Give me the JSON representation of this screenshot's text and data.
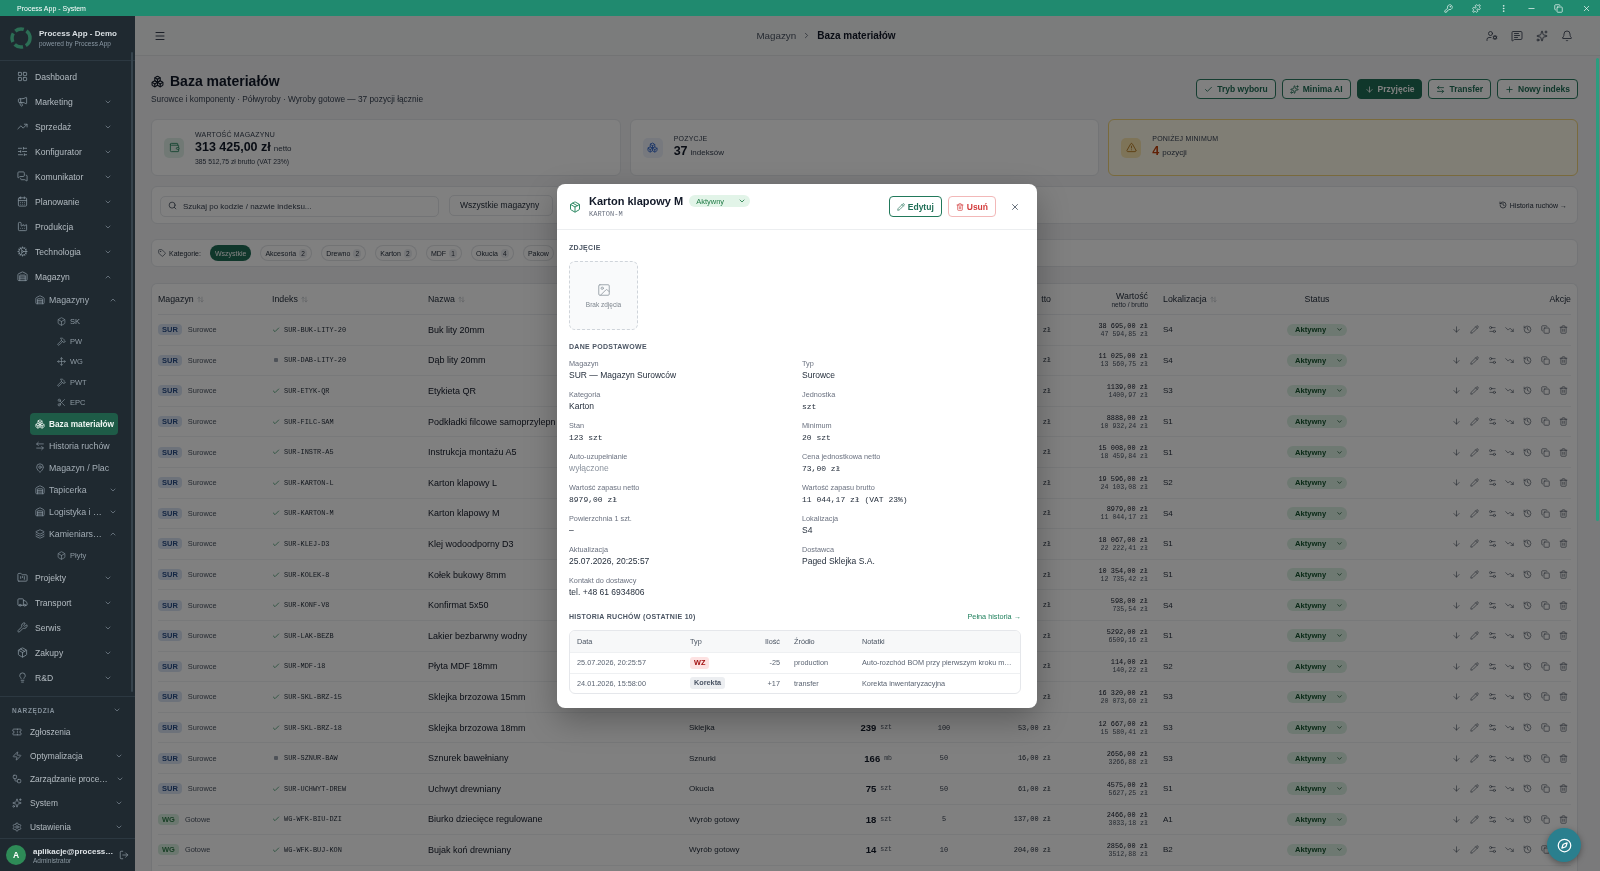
{
  "titlebar": {
    "title": "Process App - System"
  },
  "sidebar": {
    "app_name": "Process App - Demo",
    "app_tagline": "powered by Process App",
    "items": [
      {
        "label": "Dashboard",
        "selected": false
      },
      {
        "label": "Marketing",
        "selected": false,
        "expanded": false
      },
      {
        "label": "Sprzedaż",
        "selected": false,
        "expanded": false
      },
      {
        "label": "Konfigurator",
        "selected": false,
        "expanded": false
      },
      {
        "label": "Komunikator",
        "selected": false,
        "expanded": false
      },
      {
        "label": "Planowanie",
        "selected": false,
        "expanded": false
      },
      {
        "label": "Produkcja",
        "selected": false,
        "expanded": false
      },
      {
        "label": "Technologia",
        "selected": false,
        "expanded": false
      },
      {
        "label": "Magazyn",
        "selected": false,
        "expanded": true,
        "children": [
          {
            "label": "Magazyny",
            "selected": false,
            "expanded": true,
            "children": [
              {
                "label": "SK",
                "selected": false
              },
              {
                "label": "PW",
                "selected": false
              },
              {
                "label": "WG",
                "selected": false
              },
              {
                "label": "PWT",
                "selected": false
              },
              {
                "label": "EPC",
                "selected": false
              }
            ]
          },
          {
            "label": "Baza materiałów",
            "selected": true
          },
          {
            "label": "Historia ruchów",
            "selected": false
          },
          {
            "label": "Magazyn / Plac",
            "selected": false
          },
          {
            "label": "Tapicerka",
            "selected": false,
            "expanded": false
          },
          {
            "label": "Logistyka i …",
            "selected": false,
            "expanded": false
          },
          {
            "label": "Kamieniars…",
            "selected": false,
            "expanded": true,
            "children": [
              {
                "label": "Płyty",
                "selected": false
              }
            ]
          }
        ]
      },
      {
        "label": "Projekty",
        "selected": false,
        "expanded": false
      },
      {
        "label": "Transport",
        "selected": false,
        "expanded": false
      },
      {
        "label": "Serwis",
        "selected": false,
        "expanded": false
      },
      {
        "label": "Zakupy",
        "selected": false,
        "expanded": false
      },
      {
        "label": "R&D",
        "selected": false,
        "expanded": false
      }
    ],
    "tools": {
      "title": "NARZĘDZIA",
      "items": [
        {
          "label": "Zgłoszenia",
          "selected": false
        },
        {
          "label": "Optymalizacja",
          "selected": false,
          "expanded": false
        },
        {
          "label": "Zarządzanie proce…",
          "selected": false,
          "expanded": false
        },
        {
          "label": "System",
          "selected": false,
          "expanded": false
        },
        {
          "label": "Ustawienia",
          "selected": false,
          "expanded": false
        }
      ]
    },
    "user": {
      "initial": "A",
      "name": "aplikacje@process…",
      "role": "Administrator"
    }
  },
  "header": {
    "breadcrumb": [
      {
        "label": "Magazyn",
        "current": false
      },
      {
        "label": "Baza materiałów",
        "current": true
      }
    ]
  },
  "page": {
    "title": "Baza materiałów",
    "subtitle": "Surowce i komponenty · Półwyroby · Wyroby gotowe — 37 pozycji łącznie",
    "actions": [
      {
        "label": "Tryb wyboru",
        "kind": "outline"
      },
      {
        "label": "Minima AI",
        "kind": "outline"
      },
      {
        "label": "Przyjęcie",
        "kind": "primary"
      },
      {
        "label": "Transfer",
        "kind": "outline"
      },
      {
        "label": "Nowy indeks",
        "kind": "outline"
      }
    ]
  },
  "stats": [
    {
      "kind": "default",
      "label": "WARTOŚĆ MAGAZYNU",
      "value": "313 425,00 zł",
      "unit": "netto",
      "note": "385 512,75 zł brutto (VAT 23%)"
    },
    {
      "kind": "default",
      "label": "POZYCJE",
      "value": "37",
      "unit": "indeksów"
    },
    {
      "kind": "warning",
      "label": "PONIŻEJ MINIMUM",
      "value": "4",
      "unit": "pozycji"
    }
  ],
  "filters": {
    "search": {
      "placeholder": "Szukaj po kodzie / nazwie indeksu..."
    },
    "warehouse_select": "Wszystkie magazyny",
    "history_link": "Historia ruchów →"
  },
  "categories": {
    "label": "Kategorie:",
    "chips": [
      {
        "label": "Wszystkie",
        "selected": true
      },
      {
        "label": "Akcesoria",
        "count": "2",
        "selected": false
      },
      {
        "label": "Drewno",
        "count": "2",
        "selected": false
      },
      {
        "label": "Karton",
        "count": "2",
        "selected": false
      },
      {
        "label": "MDF",
        "count": "1",
        "selected": false
      },
      {
        "label": "Okucia",
        "count": "4",
        "selected": false
      },
      {
        "label": "Pakow",
        "selected": false
      }
    ]
  },
  "table": {
    "columns": {
      "warehouse": {
        "label": "Magazyn",
        "sortable": true
      },
      "index": {
        "label": "Indeks",
        "sortable": true
      },
      "name": {
        "label": "Nazwa",
        "sortable": true
      },
      "column_7": {
        "label": "tto"
      },
      "value": {
        "label": "Wartość",
        "sublabel": "netto / brutto"
      },
      "location": {
        "label": "Lokalizacja",
        "sortable": true
      },
      "status": {
        "label": "Status"
      },
      "actions": {
        "label": "Akcje"
      }
    },
    "rows": [
      {
        "warehouse": {
          "code": "SUR",
          "type": "Surowce",
          "color": "#6d727a"
        },
        "index": {
          "code": "SUR-BUK-LITY-20",
          "checked": true
        },
        "name": "Buk lity 20mm",
        "column_7": "zł",
        "value": {
          "net": "38 695,00 zł",
          "gross": "47 594,85 zł"
        },
        "location": "S4",
        "status": "Aktywny"
      },
      {
        "warehouse": {
          "code": "SUR",
          "type": "Surowce",
          "color": "#6d727a"
        },
        "index": {
          "code": "SUR-DAB-LITY-20",
          "checked": false
        },
        "name": "Dąb lity 20mm",
        "column_7": "zł",
        "value": {
          "net": "11 025,00 zł",
          "gross": "13 560,75 zł"
        },
        "location": "S4",
        "status": "Aktywny"
      },
      {
        "warehouse": {
          "code": "SUR",
          "type": "Surowce",
          "color": "#6d727a"
        },
        "index": {
          "code": "SUR-ETYK-QR",
          "checked": true
        },
        "name": "Etykieta QR",
        "column_7": "zł",
        "value": {
          "net": "1139,00 zł",
          "gross": "1400,97 zł"
        },
        "location": "S3",
        "status": "Aktywny"
      },
      {
        "warehouse": {
          "code": "SUR",
          "type": "Surowce",
          "color": "#6d727a"
        },
        "index": {
          "code": "SUR-FILC-SAM",
          "checked": true
        },
        "name": "Podkładki filcowe samoprzylepn",
        "column_7": "zł",
        "value": {
          "net": "8888,00 zł",
          "gross": "10 932,24 zł"
        },
        "location": "S1",
        "status": "Aktywny"
      },
      {
        "warehouse": {
          "code": "SUR",
          "type": "Surowce",
          "color": "#6d727a"
        },
        "index": {
          "code": "SUR-INSTR-A5",
          "checked": true
        },
        "name": "Instrukcja montażu A5",
        "column_7": "zł",
        "value": {
          "net": "15 008,00 zł",
          "gross": "18 459,84 zł"
        },
        "location": "S1",
        "status": "Aktywny"
      },
      {
        "warehouse": {
          "code": "SUR",
          "type": "Surowce",
          "color": "#6d727a"
        },
        "index": {
          "code": "SUR-KARTON-L",
          "checked": true
        },
        "name": "Karton klapowy L",
        "column_7": "zł",
        "value": {
          "net": "19 596,00 zł",
          "gross": "24 103,08 zł"
        },
        "location": "S2",
        "status": "Aktywny"
      },
      {
        "warehouse": {
          "code": "SUR",
          "type": "Surowce",
          "color": "#6d727a"
        },
        "index": {
          "code": "SUR-KARTON-M",
          "checked": true
        },
        "name": "Karton klapowy M",
        "column_7": "zł",
        "value": {
          "net": "8979,00 zł",
          "gross": "11 044,17 zł"
        },
        "location": "S4",
        "status": "Aktywny"
      },
      {
        "warehouse": {
          "code": "SUR",
          "type": "Surowce",
          "color": "#6d727a"
        },
        "index": {
          "code": "SUR-KLEJ-D3",
          "checked": true
        },
        "name": "Klej wodoodporny D3",
        "column_7": "zł",
        "value": {
          "net": "18 067,00 zł",
          "gross": "22 222,41 zł"
        },
        "location": "S1",
        "status": "Aktywny"
      },
      {
        "warehouse": {
          "code": "SUR",
          "type": "Surowce",
          "color": "#6d727a"
        },
        "index": {
          "code": "SUR-KOLEK-8",
          "checked": true
        },
        "name": "Kołek bukowy 8mm",
        "column_7": "zł",
        "value": {
          "net": "10 354,00 zł",
          "gross": "12 735,42 zł"
        },
        "location": "S1",
        "status": "Aktywny"
      },
      {
        "warehouse": {
          "code": "SUR",
          "type": "Surowce",
          "color": "#6d727a"
        },
        "index": {
          "code": "SUR-KONF-V8",
          "checked": true
        },
        "name": "Konfirmat 5x50",
        "column_7": "zł",
        "value": {
          "net": "598,00 zł",
          "gross": "735,54 zł"
        },
        "location": "S4",
        "status": "Aktywny"
      },
      {
        "warehouse": {
          "code": "SUR",
          "type": "Surowce",
          "color": "#6d727a"
        },
        "index": {
          "code": "SUR-LAK-BEZB",
          "checked": true
        },
        "name": "Lakier bezbarwny wodny",
        "column_7": "zł",
        "value": {
          "net": "5292,00 zł",
          "gross": "6509,16 zł"
        },
        "location": "S1",
        "status": "Aktywny"
      },
      {
        "warehouse": {
          "code": "SUR",
          "type": "Surowce",
          "color": "#6d727a"
        },
        "index": {
          "code": "SUR-MDF-18",
          "checked": true
        },
        "name": "Płyta MDF 18mm",
        "column_7": "zł",
        "value": {
          "net": "114,00 zł",
          "gross": "140,22 zł"
        },
        "location": "S2",
        "status": "Aktywny"
      },
      {
        "warehouse": {
          "code": "SUR",
          "type": "Surowce",
          "color": "#6d727a"
        },
        "index": {
          "code": "SUR-SKL-BRZ-15",
          "checked": true
        },
        "name": "Sklejka brzozowa 15mm",
        "column_7": "zł",
        "value": {
          "net": "16 320,00 zł",
          "gross": "20 073,60 zł"
        },
        "location": "S3",
        "status": "Aktywny"
      },
      {
        "warehouse": {
          "code": "SUR",
          "type": "Surowce",
          "color": "#6d727a"
        },
        "index": {
          "code": "SUR-SKL-BRZ-18",
          "checked": true
        },
        "name": "Sklejka brzozowa 18mm",
        "column_4": "Sklejka",
        "column_5": {
          "value": "239",
          "unit": "szt"
        },
        "column_6": "100",
        "column_7": "53,00 zł",
        "value": {
          "net": "12 667,00 zł",
          "gross": "15 580,41 zł"
        },
        "location": "S3",
        "status": "Aktywny"
      },
      {
        "warehouse": {
          "code": "SUR",
          "type": "Surowce",
          "color": "#6d727a"
        },
        "index": {
          "code": "SUR-SZNUR-BAW",
          "checked": false
        },
        "name": "Sznurek bawełniany",
        "column_4": "Sznurki",
        "column_5": {
          "value": "166",
          "unit": "mb"
        },
        "column_6": "50",
        "column_7": "16,00 zł",
        "value": {
          "net": "2656,00 zł",
          "gross": "3266,88 zł"
        },
        "location": "S3",
        "status": "Aktywny"
      },
      {
        "warehouse": {
          "code": "SUR",
          "type": "Surowce",
          "color": "#6d727a"
        },
        "index": {
          "code": "SUR-UCHWYT-DREW",
          "checked": true
        },
        "name": "Uchwyt drewniany",
        "column_4": "Okucia",
        "column_5": {
          "value": "75",
          "unit": "szt"
        },
        "column_6": "50",
        "column_7": "61,00 zł",
        "value": {
          "net": "4575,00 zł",
          "gross": "5627,25 zł"
        },
        "location": "S1",
        "status": "Aktywny"
      },
      {
        "warehouse": {
          "code": "WG",
          "type": "Gotowe",
          "color": "#6c7870"
        },
        "index": {
          "code": "WG-WFK-BIU-DZI",
          "checked": true
        },
        "name": "Biurko dziecięce regulowane",
        "column_4": "Wyrób gotowy",
        "column_5": {
          "value": "18",
          "unit": "szt"
        },
        "column_6": "5",
        "column_7": "137,00 zł",
        "value": {
          "net": "2466,00 zł",
          "gross": "3033,18 zł"
        },
        "location": "A1",
        "status": "Aktywny"
      },
      {
        "warehouse": {
          "code": "WG",
          "type": "Gotowe",
          "color": "#6c7870"
        },
        "index": {
          "code": "WG-WFK-BUJ-KON",
          "checked": true
        },
        "name": "Bujak koń drewniany",
        "column_4": "Wyrób gotowy",
        "column_5": {
          "value": "14",
          "unit": "szt"
        },
        "column_6": "10",
        "column_7": "204,00 zł",
        "value": {
          "net": "2856,00 zł",
          "gross": "3512,88 zł"
        },
        "location": "B2",
        "status": "Aktywny"
      }
    ]
  },
  "modal": {
    "title": "Karton klapowy M",
    "code": "KARTON-M",
    "status": "Aktywny",
    "buttons": [
      {
        "label": "Edytuj",
        "kind": "edit"
      },
      {
        "label": "Usuń",
        "kind": "delete"
      }
    ],
    "photo": {
      "title": "ZDJĘCIE",
      "empty_text": "Brak zdjęcia"
    },
    "details": {
      "title": "DANE PODSTAWOWE",
      "fields": [
        {
          "label": "Magazyn",
          "value": "SUR — Magazyn Surowców",
          "kind": "text"
        },
        {
          "label": "Typ",
          "value": "Surowce",
          "kind": "text"
        },
        {
          "label": "Kategoria",
          "value": "Karton",
          "kind": "text"
        },
        {
          "label": "Jednostka",
          "value": "szt",
          "kind": "mono"
        },
        {
          "label": "Stan",
          "value": "123 szt",
          "kind": "mono"
        },
        {
          "label": "Minimum",
          "value": "20 szt",
          "kind": "mono"
        },
        {
          "label": "Auto-uzupełnianie",
          "value": "wyłączone",
          "kind": "muted"
        },
        {
          "label": "Cena jednostkowa netto",
          "value": "73,00 zł",
          "kind": "mono"
        },
        {
          "label": "Wartość zapasu netto",
          "value": "8979,00 zł",
          "kind": "mono"
        },
        {
          "label": "Wartość zapasu brutto",
          "value": "11 044,17 zł (VAT 23%)",
          "kind": "mono"
        },
        {
          "label": "Powierzchnia 1 szt.",
          "value": "–",
          "kind": "text"
        },
        {
          "label": "Lokalizacja",
          "value": "S4",
          "kind": "text"
        },
        {
          "label": "Aktualizacja",
          "value": "25.07.2026, 20:25:57",
          "kind": "text"
        },
        {
          "label": "Dostawca",
          "value": "Paged Sklejka S.A.",
          "kind": "text"
        },
        {
          "label": "Kontakt do dostawcy",
          "value": "tel. +48 61 6934806",
          "kind": "text"
        }
      ]
    },
    "history": {
      "title": "HISTORIA RUCHÓW (OSTATNIE 10)",
      "link": "Pełna historia →",
      "columns": [
        "Data",
        "Typ",
        "Ilość",
        "Źródło",
        "Notatki"
      ],
      "rows": [
        {
          "date": "25.07.2026, 20:25:57",
          "type": "WZ",
          "color": "#fde2e2",
          "quantity": "-25",
          "source": "production",
          "notes": "Auto-rozchód BOM przy pierwszym kroku m…"
        },
        {
          "date": "24.01.2026, 15:58:00",
          "type": "Korekta",
          "color": "#eceef1",
          "quantity": "+17",
          "source": "transfer",
          "notes": "Korekta inwentaryzacyjna"
        }
      ]
    }
  }
}
